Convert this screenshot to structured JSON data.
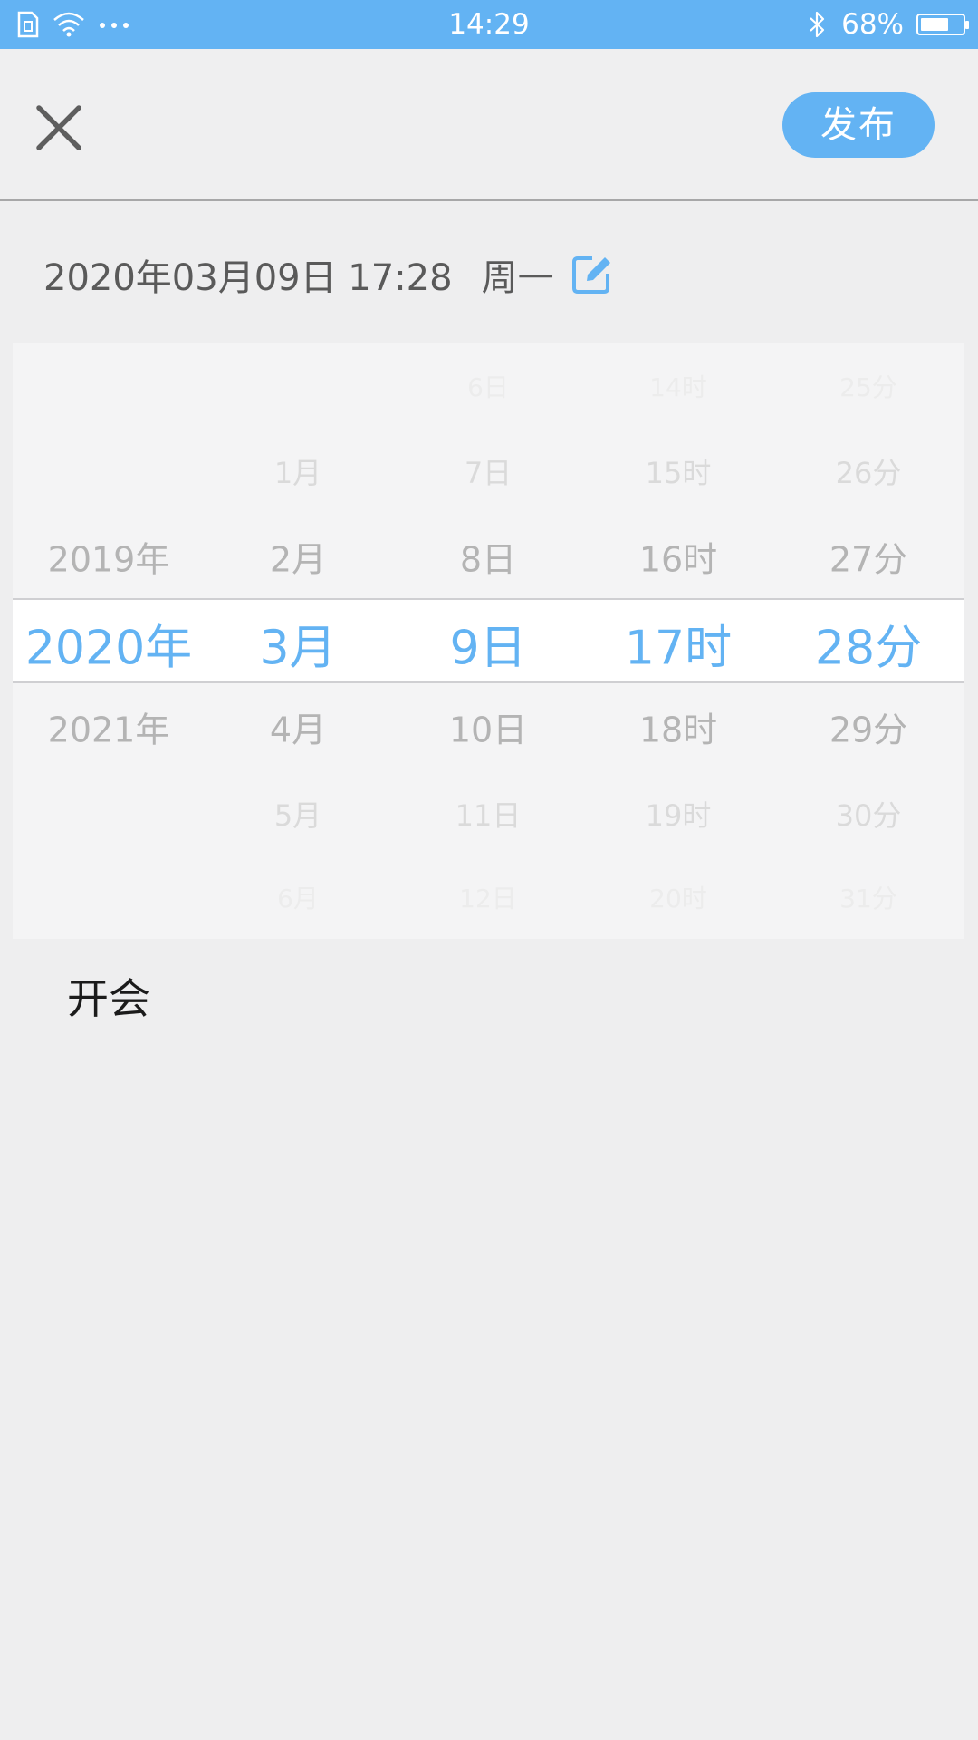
{
  "status_bar": {
    "time": "14:29",
    "battery": "68%",
    "battery_level": 0.68,
    "icons": [
      "sim-icon",
      "wifi-icon",
      "more-dots-icon",
      "bluetooth-icon",
      "battery-icon"
    ]
  },
  "header": {
    "close_icon": "close-icon",
    "publish_label": "发布"
  },
  "date_line": {
    "datetime": "2020年03月09日 17:28",
    "weekday": "周一",
    "edit_icon": "edit-icon"
  },
  "picker": {
    "year": {
      "above": [
        "",
        "",
        "2019年"
      ],
      "selected": "2020年",
      "below": [
        "2021年",
        "",
        ""
      ]
    },
    "month": {
      "above": [
        "",
        "1月",
        "2月"
      ],
      "selected": "3月",
      "below": [
        "4月",
        "5月",
        "6月"
      ]
    },
    "day": {
      "above": [
        "6日",
        "7日",
        "8日"
      ],
      "selected": "9日",
      "below": [
        "10日",
        "11日",
        "12日"
      ]
    },
    "hour": {
      "above": [
        "14时",
        "15时",
        "16时"
      ],
      "selected": "17时",
      "below": [
        "18时",
        "19时",
        "20时"
      ]
    },
    "minute": {
      "above": [
        "25分",
        "26分",
        "27分"
      ],
      "selected": "28分",
      "below": [
        "29分",
        "30分",
        "31分"
      ]
    }
  },
  "content": {
    "text": "开会"
  },
  "colors": {
    "accent": "#63b3f3",
    "background": "#eeeeef",
    "text": "#5a5a5a"
  }
}
